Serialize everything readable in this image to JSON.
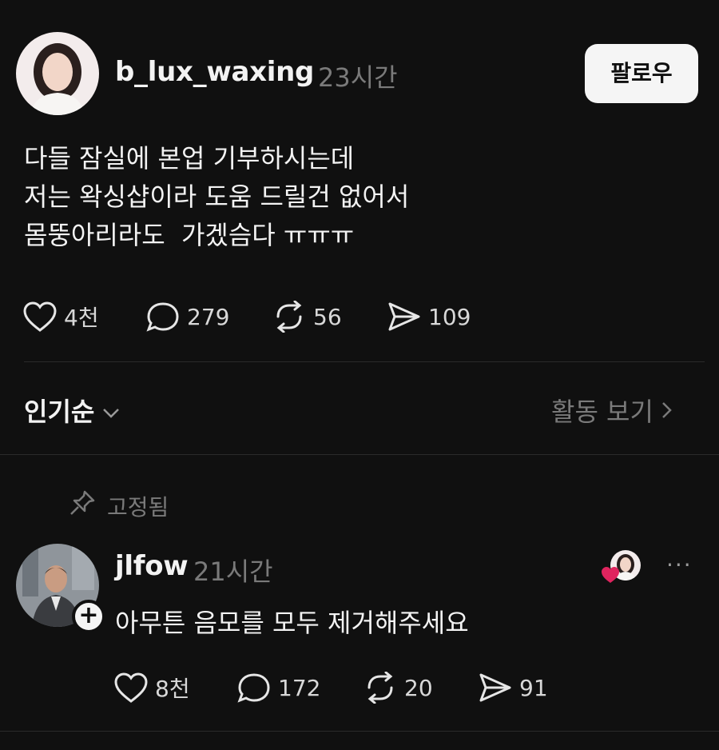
{
  "post": {
    "username": "b_lux_waxing",
    "time": "23시간",
    "follow_label": "팔로우",
    "lines": [
      "다들 잠실에 본업 기부하시는데",
      "저는 왁싱샵이라 도움 드릴건 없어서",
      "몸뚱아리라도  가겠슴다 ㅠㅠㅠ"
    ],
    "likes": "4천",
    "comments": "279",
    "reposts": "56",
    "shares": "109"
  },
  "sort": {
    "label": "인기순",
    "activity_label": "활동 보기"
  },
  "comment": {
    "pinned_label": "고정됨",
    "username": "jlfow",
    "time": "21시간",
    "text": "아무튼 음모를 모두 제거해주세요",
    "likes": "8천",
    "comments": "172",
    "reposts": "20",
    "shares": "91",
    "more_label": "···"
  },
  "colors": {
    "background": "#101010",
    "heart_badge": "#e0245e",
    "muted_text": "#7a7a7a"
  },
  "icons": [
    "heart-icon",
    "comment-icon",
    "repost-icon",
    "share-icon",
    "chevron-down-icon",
    "chevron-right-icon",
    "pin-icon",
    "plus-icon",
    "more-icon"
  ]
}
